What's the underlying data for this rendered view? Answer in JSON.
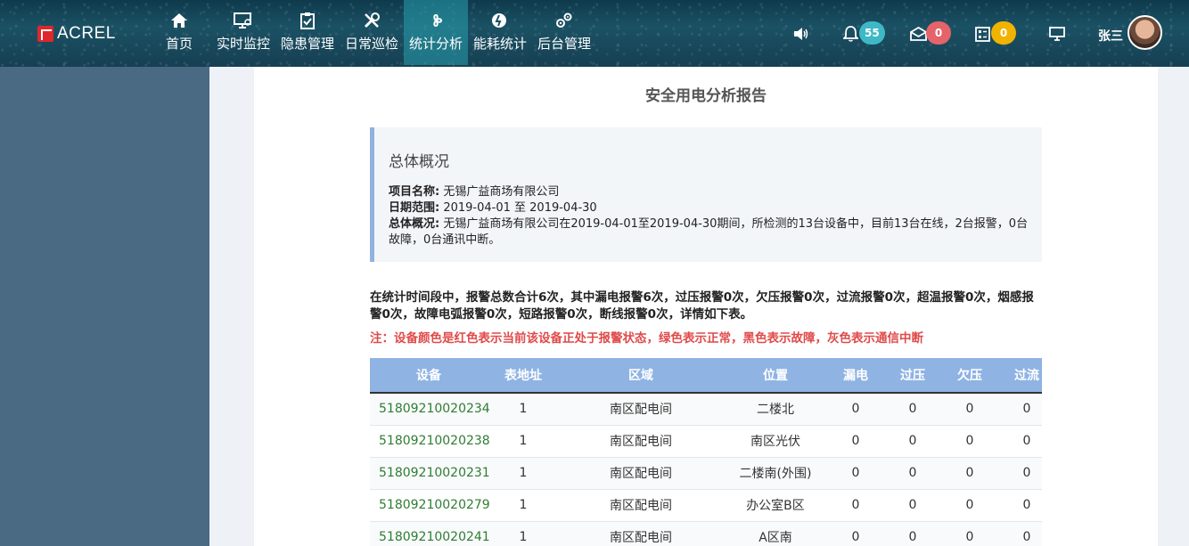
{
  "header": {
    "logo_text": "ACREL",
    "nav": [
      {
        "label": "首页",
        "icon": "home-icon",
        "active": false
      },
      {
        "label": "实时监控",
        "icon": "monitor-icon",
        "active": false
      },
      {
        "label": "隐患管理",
        "icon": "clipboard-icon",
        "active": false
      },
      {
        "label": "日常巡检",
        "icon": "tools-icon",
        "active": false
      },
      {
        "label": "统计分析",
        "icon": "analysis-icon",
        "active": true
      },
      {
        "label": "能耗统计",
        "icon": "energy-icon",
        "active": false
      },
      {
        "label": "后台管理",
        "icon": "settings-icon",
        "active": false
      }
    ],
    "tools": {
      "bell_count": "55",
      "mail_count": "0",
      "task_count": "0",
      "bell_color": "#3fb8c6",
      "mail_color": "#e5636a",
      "task_color": "#f0b400"
    },
    "user_name": "张三"
  },
  "report": {
    "title": "安全用电分析报告",
    "overview_heading": "总体概况",
    "project_key": "项目名称:",
    "project_value": "无锡广益商场有限公司",
    "date_key": "日期范围:",
    "date_value": "2019-04-01 至 2019-04-30",
    "summary_key": "总体概况:",
    "summary_value": "无锡广益商场有限公司在2019-04-01至2019-04-30期间，所检测的13台设备中，目前13台在线，2台报警，0台故障，0台通讯中断。",
    "stats_text": "在统计时间段中，报警总数合计6次，其中漏电报警6次，过压报警0次，欠压报警0次，过流报警0次，超温报警0次，烟感报警0次，故障电弧报警0次，短路报警0次，断线报警0次，详情如下表。",
    "note_text": "注：设备颜色是红色表示当前该设备正处于报警状态，绿色表示正常，黑色表示故障，灰色表示通信中断"
  },
  "table": {
    "columns": [
      "设备",
      "表地址",
      "区域",
      "位置",
      "漏电",
      "过压",
      "欠压",
      "过流"
    ],
    "rows": [
      [
        "51809210020234",
        "1",
        "南区配电间",
        "二楼北",
        "0",
        "0",
        "0",
        "0"
      ],
      [
        "51809210020238",
        "1",
        "南区配电间",
        "南区光伏",
        "0",
        "0",
        "0",
        "0"
      ],
      [
        "51809210020231",
        "1",
        "南区配电间",
        "二楼南(外围)",
        "0",
        "0",
        "0",
        "0"
      ],
      [
        "51809210020279",
        "1",
        "南区配电间",
        "办公室B区",
        "0",
        "0",
        "0",
        "0"
      ],
      [
        "51809210020241",
        "1",
        "南区配电间",
        "A区南",
        "0",
        "0",
        "0",
        "0"
      ]
    ]
  }
}
